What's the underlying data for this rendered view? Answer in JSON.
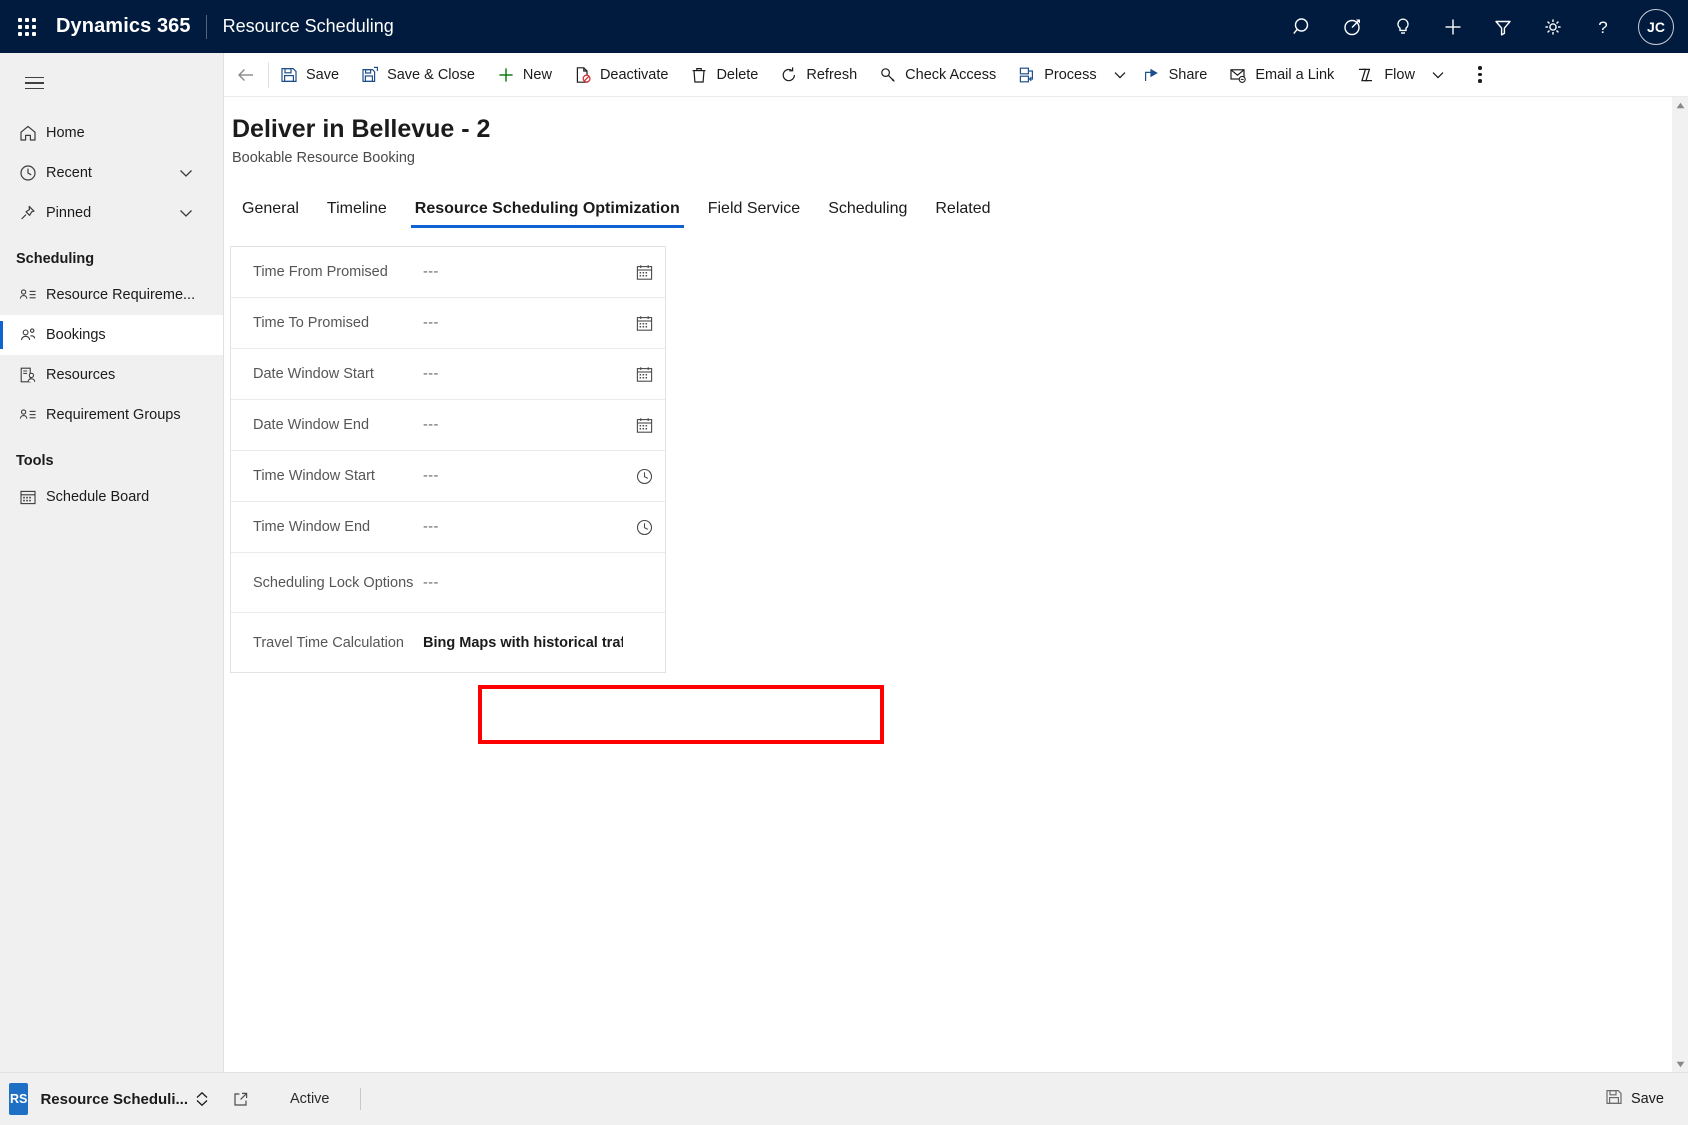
{
  "topbar": {
    "waffle_icon": "waffle-grid-icon",
    "brand": "Dynamics 365",
    "app_name": "Resource Scheduling",
    "icons": [
      {
        "name": "search-icon",
        "label": "Search"
      },
      {
        "name": "assistant-icon",
        "label": "Assistant"
      },
      {
        "name": "lightbulb-icon",
        "label": "Insights"
      },
      {
        "name": "plus-icon",
        "label": "Quick Create"
      },
      {
        "name": "filter-icon",
        "label": "Filter"
      },
      {
        "name": "gear-icon",
        "label": "Settings"
      },
      {
        "name": "help-icon",
        "label": "Help"
      }
    ],
    "avatar_initials": "JC"
  },
  "sidebar": {
    "hamburger_label": "Site Map",
    "items": [
      {
        "label": "Home",
        "icon": "home-icon",
        "chevron": false,
        "selected": false
      },
      {
        "label": "Recent",
        "icon": "clock-icon",
        "chevron": true,
        "selected": false
      },
      {
        "label": "Pinned",
        "icon": "pin-icon",
        "chevron": true,
        "selected": false
      }
    ],
    "groups": [
      {
        "title": "Scheduling",
        "items": [
          {
            "label": "Resource Requireme...",
            "icon": "person-list-icon",
            "selected": false
          },
          {
            "label": "Bookings",
            "icon": "people-icon",
            "selected": true
          },
          {
            "label": "Resources",
            "icon": "resource-icon",
            "selected": false
          },
          {
            "label": "Requirement Groups",
            "icon": "person-list-icon",
            "selected": false
          }
        ]
      },
      {
        "title": "Tools",
        "items": [
          {
            "label": "Schedule Board",
            "icon": "calendar-icon",
            "selected": false
          }
        ]
      }
    ],
    "app_switcher": {
      "badge": "RS",
      "label": "Resource Scheduli...",
      "chevron_icon": "chevron-updown-icon"
    }
  },
  "commandbar": {
    "back_icon": "arrow-left-icon",
    "commands": [
      {
        "label": "Save",
        "icon": "save-icon",
        "chevron": false
      },
      {
        "label": "Save & Close",
        "icon": "save-close-icon",
        "chevron": false
      },
      {
        "label": "New",
        "icon": "plus-icon",
        "chevron": false
      },
      {
        "label": "Deactivate",
        "icon": "deactivate-icon",
        "chevron": false
      },
      {
        "label": "Delete",
        "icon": "trash-icon",
        "chevron": false
      },
      {
        "label": "Refresh",
        "icon": "refresh-icon",
        "chevron": false
      },
      {
        "label": "Check Access",
        "icon": "key-icon",
        "chevron": false
      },
      {
        "label": "Process",
        "icon": "process-icon",
        "chevron": true
      },
      {
        "label": "Share",
        "icon": "share-icon",
        "chevron": false
      },
      {
        "label": "Email a Link",
        "icon": "email-link-icon",
        "chevron": false
      },
      {
        "label": "Flow",
        "icon": "flow-icon",
        "chevron": true
      }
    ],
    "overflow_label": "More commands"
  },
  "record": {
    "title": "Deliver in Bellevue - 2",
    "subtitle": "Bookable Resource Booking"
  },
  "tabs": [
    {
      "label": "General",
      "active": false
    },
    {
      "label": "Timeline",
      "active": false
    },
    {
      "label": "Resource Scheduling Optimization",
      "active": true
    },
    {
      "label": "Field Service",
      "active": false
    },
    {
      "label": "Scheduling",
      "active": false
    },
    {
      "label": "Related",
      "active": false
    }
  ],
  "form": {
    "fields": [
      {
        "label": "Time From Promised",
        "value": "---",
        "placeholder": true,
        "bold": false,
        "icon": "calendar-icon"
      },
      {
        "label": "Time To Promised",
        "value": "---",
        "placeholder": true,
        "bold": false,
        "icon": "calendar-icon"
      },
      {
        "label": "Date Window Start",
        "value": "---",
        "placeholder": true,
        "bold": false,
        "icon": "calendar-icon"
      },
      {
        "label": "Date Window End",
        "value": "---",
        "placeholder": true,
        "bold": false,
        "icon": "calendar-icon"
      },
      {
        "label": "Time Window Start",
        "value": "---",
        "placeholder": true,
        "bold": false,
        "icon": "clock-icon"
      },
      {
        "label": "Time Window End",
        "value": "---",
        "placeholder": true,
        "bold": false,
        "icon": "clock-icon"
      },
      {
        "label": "Scheduling Lock Options",
        "value": "---",
        "placeholder": true,
        "bold": false,
        "icon": "none"
      },
      {
        "label": "Travel Time Calculation",
        "value": "Bing Maps with historical traffic",
        "placeholder": false,
        "bold": true,
        "icon": "none"
      }
    ],
    "highlight_field": "Travel Time Calculation",
    "highlight_color": "#ff0000"
  },
  "statusbar": {
    "popout_icon": "open-in-new-icon",
    "status": "Active",
    "save_label": "Save",
    "save_icon": "save-icon"
  },
  "colors": {
    "topbar_bg": "#001b3d",
    "accent": "#0f62d1",
    "sidebar_bg": "#f0f0f0",
    "highlight": "#ff0000"
  }
}
